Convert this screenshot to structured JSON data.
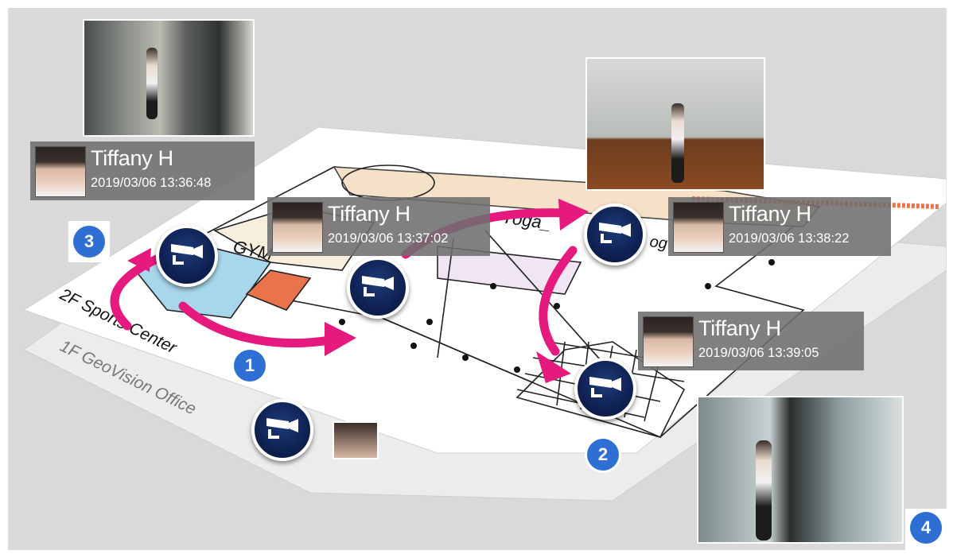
{
  "floors": {
    "upper": "2F Sports Center",
    "lower": "1F GeoVision Office",
    "room_gym": "GYM",
    "room_yoga": "Yoga_",
    "room_yoga2": "og"
  },
  "tracks": [
    {
      "step": "1",
      "name": "Tiffany H",
      "time": "2019/03/06 13:37:02"
    },
    {
      "step": "2",
      "name": "Tiffany H",
      "time": "2019/03/06 13:39:05"
    },
    {
      "step": "3",
      "name": "Tiffany H",
      "time": "2019/03/06 13:36:48"
    },
    {
      "step": "4",
      "name": "Tiffany H",
      "time": "2019/03/06 13:38:22"
    }
  ],
  "colors": {
    "background": "#d9d9d9",
    "arrow": "#e6197f",
    "camera": "#0e2152",
    "badge": "#2f6fd4"
  },
  "icons": [
    "camera-icon",
    "path-arrow"
  ]
}
